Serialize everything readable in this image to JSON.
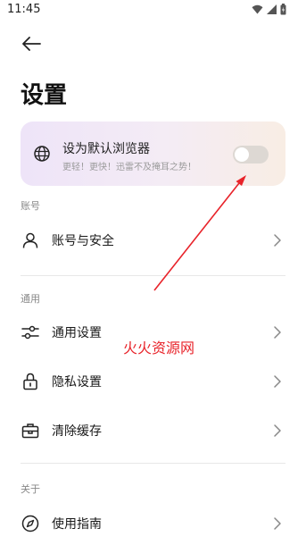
{
  "status_bar": {
    "time": "11:45"
  },
  "header": {
    "title": "设置"
  },
  "default_browser": {
    "title": "设为默认浏览器",
    "subtitle": "更轻！更快！迅雷不及掩耳之势！",
    "toggle_on": false
  },
  "sections": {
    "account": {
      "header": "账号",
      "items": [
        {
          "label": "账号与安全",
          "icon": "person-icon"
        }
      ]
    },
    "general": {
      "header": "通用",
      "items": [
        {
          "label": "通用设置",
          "icon": "sliders-icon"
        },
        {
          "label": "隐私设置",
          "icon": "lock-icon"
        },
        {
          "label": "清除缓存",
          "icon": "toolbox-icon"
        }
      ]
    },
    "about": {
      "header": "关于",
      "items": [
        {
          "label": "使用指南",
          "icon": "compass-icon"
        }
      ]
    }
  },
  "watermark": "火火资源网",
  "colors": {
    "annotation": "#e8232a",
    "card_start": "#eee4f8",
    "card_end": "#f8ede4"
  }
}
